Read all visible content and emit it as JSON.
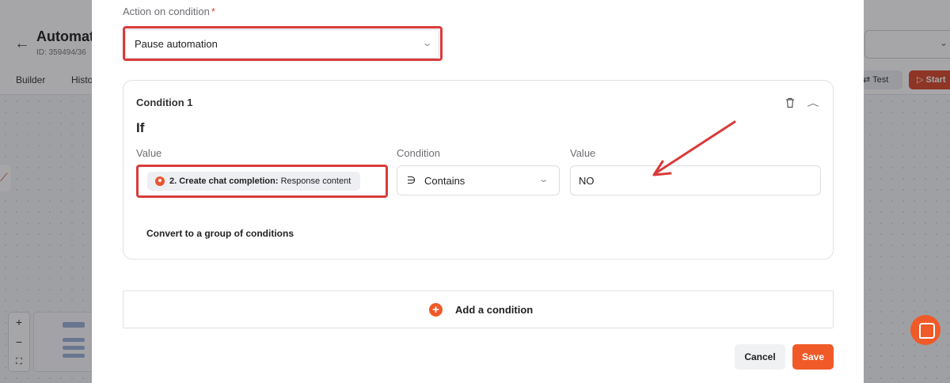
{
  "background": {
    "title": "Automati",
    "id_text": "ID: 359494/36",
    "tabs": [
      "Builder",
      "Histo"
    ],
    "test_label": "Test",
    "start_label": "Start",
    "zoom": [
      "+",
      "−",
      "⛶"
    ]
  },
  "modal": {
    "action_label": "Action on condition",
    "required_mark": "*",
    "action_value": "Pause automation",
    "condition": {
      "title": "Condition 1",
      "if_label": "If",
      "columns": {
        "value": "Value",
        "condition": "Condition",
        "value2": "Value"
      },
      "chip_step": "2. Create chat completion:",
      "chip_field": " Response content",
      "operator_symbol": "∋",
      "operator": "Contains",
      "input_value": "NO",
      "convert_label": "Convert to a group of conditions"
    },
    "add_condition_label": "Add a condition",
    "cancel_label": "Cancel",
    "save_label": "Save"
  },
  "colors": {
    "accent": "#f05a28",
    "highlight": "#d93b3b"
  },
  "icons": [
    "back-arrow-icon",
    "chevron-down-icon",
    "trash-icon",
    "chevron-up-icon",
    "plus-circle-icon",
    "chat-icon",
    "webhook-icon"
  ]
}
